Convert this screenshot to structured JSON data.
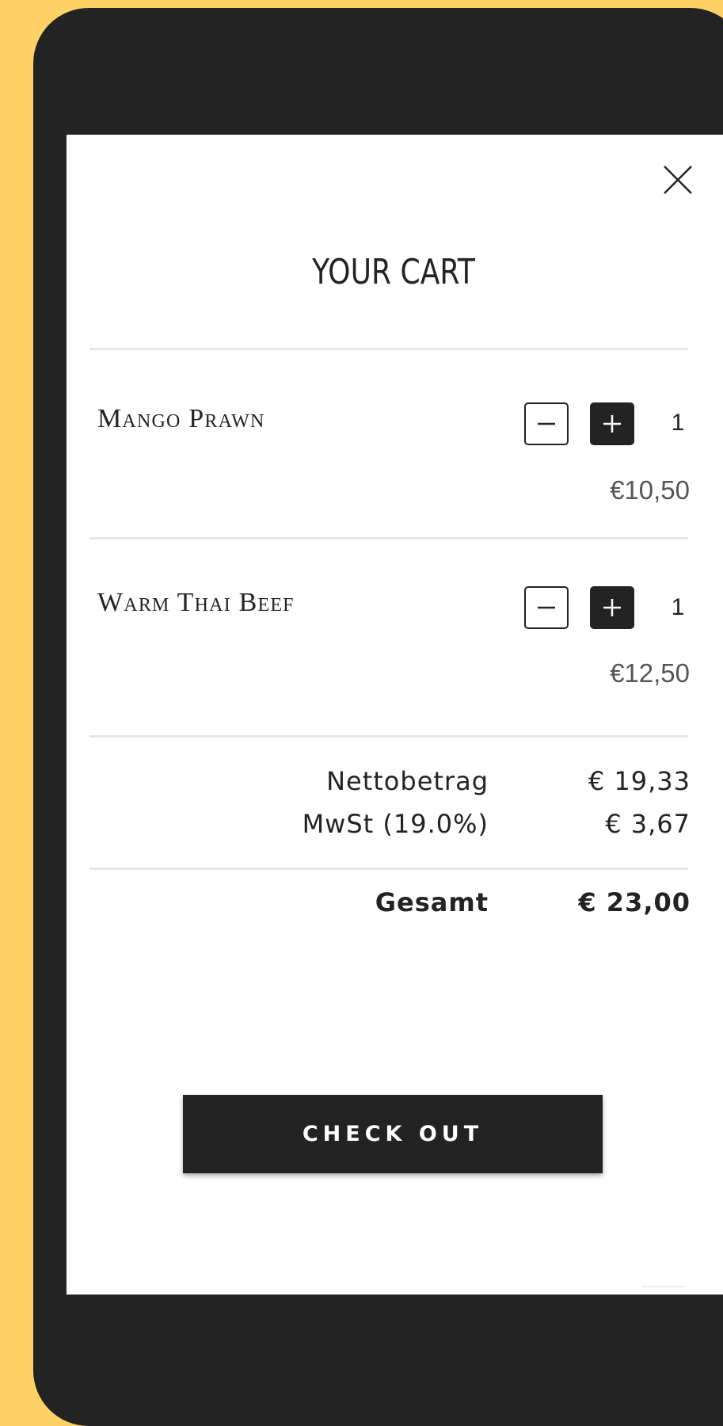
{
  "header": {
    "title": "YOUR CART",
    "close_icon": "close-icon"
  },
  "items": [
    {
      "name": "Mango Prawn",
      "qty": "1",
      "price": "€10,50"
    },
    {
      "name": "Warm Thai Beef",
      "qty": "1",
      "price": "€12,50"
    }
  ],
  "summary": {
    "net_label": "Nettobetrag",
    "net_value": "€ 19,33",
    "vat_label": "MwSt (19.0%)",
    "vat_value": "€ 3,67",
    "total_label": "Gesamt",
    "total_value": "€ 23,00"
  },
  "checkout_label": "CHECK OUT",
  "colors": {
    "background": "#FFD166",
    "frame": "#232323",
    "screen": "#FFFFFF",
    "accent": "#232323"
  }
}
